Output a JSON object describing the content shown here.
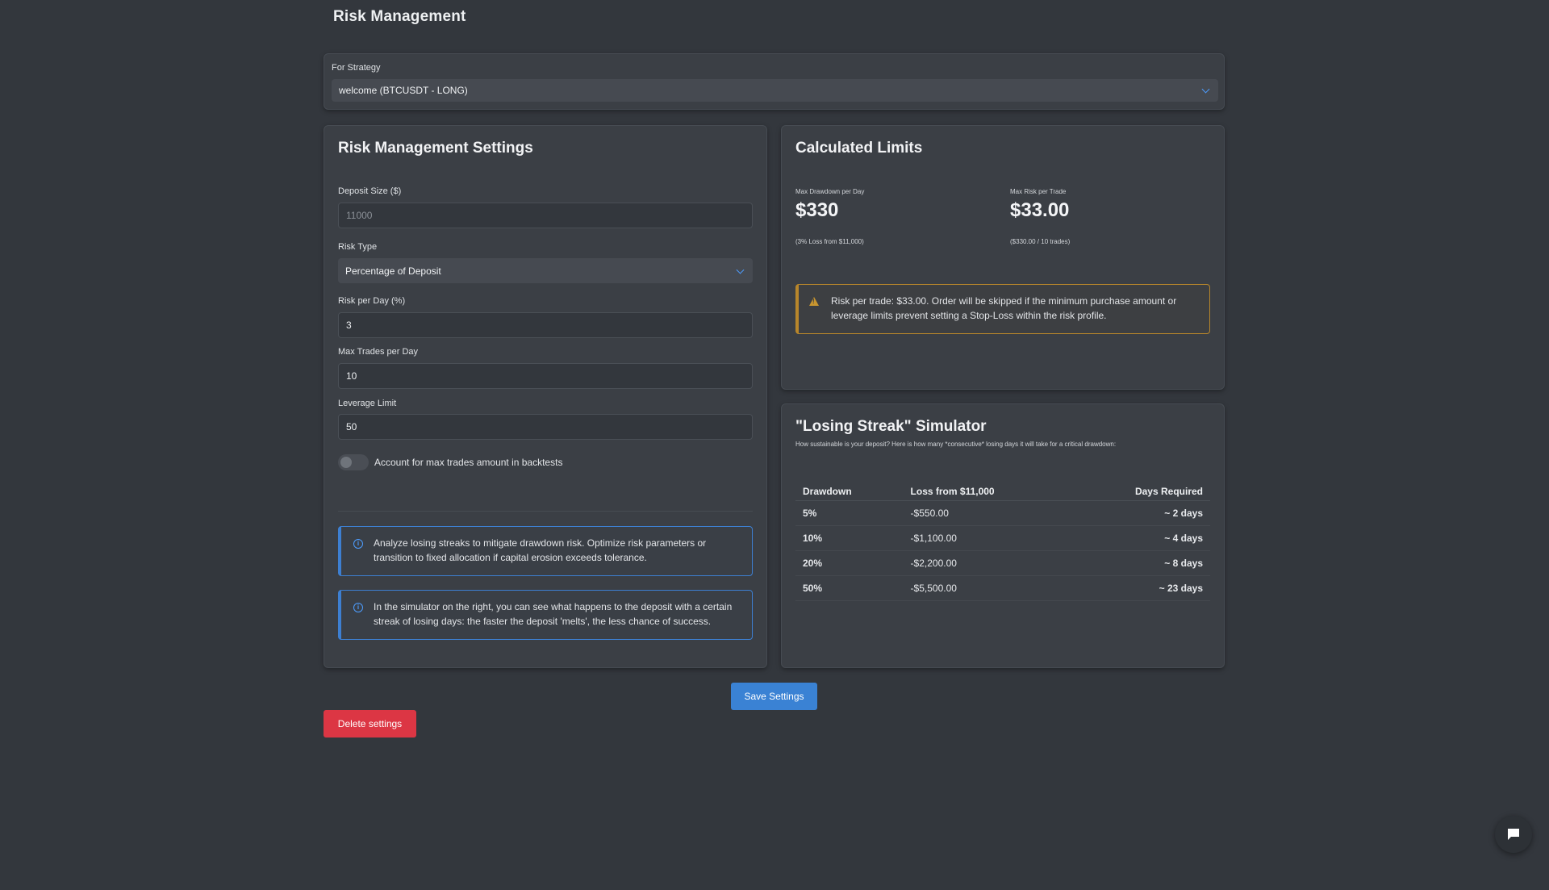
{
  "page": {
    "title": "Risk Management"
  },
  "strategy": {
    "label": "For Strategy",
    "selected": "welcome (BTCUSDT - LONG)"
  },
  "settings": {
    "title": "Risk Management Settings",
    "deposit": {
      "label": "Deposit Size ($)",
      "placeholder": "11000"
    },
    "risk_type": {
      "label": "Risk Type",
      "selected": "Percentage of Deposit"
    },
    "risk_per_day": {
      "label": "Risk per Day (%)",
      "value": "3"
    },
    "max_trades": {
      "label": "Max Trades per Day",
      "value": "10"
    },
    "leverage": {
      "label": "Leverage Limit",
      "value": "50"
    },
    "toggle": {
      "label": "Account for max trades amount in backtests",
      "checked": false
    },
    "info1": "Analyze losing streaks to mitigate drawdown risk. Optimize risk parameters or transition to fixed allocation if capital erosion exceeds tolerance.",
    "info2": "In the simulator on the right, you can see what happens to the deposit with a certain streak of losing days: the faster the deposit 'melts', the less chance of success."
  },
  "limits": {
    "title": "Calculated Limits",
    "drawdown": {
      "label": "Max Drawdown per Day",
      "value": "$330",
      "note": "(3% Loss from $11,000)"
    },
    "risk_trade": {
      "label": "Max Risk per Trade",
      "value": "$33.00",
      "note": "($330.00 / 10 trades)"
    },
    "warning": "Risk per trade: $33.00. Order will be skipped if the minimum purchase amount or leverage limits prevent setting a Stop-Loss within the risk profile."
  },
  "simulator": {
    "title": "\"Losing Streak\" Simulator",
    "subtitle": "How sustainable is your deposit? Here is how many *consecutive* losing days it will take for a critical drawdown:",
    "headers": [
      "Drawdown",
      "Loss from $11,000",
      "Days Required"
    ],
    "rows": [
      [
        "5%",
        "-$550.00",
        "~ 2 days"
      ],
      [
        "10%",
        "-$1,100.00",
        "~ 4 days"
      ],
      [
        "20%",
        "-$2,200.00",
        "~ 8 days"
      ],
      [
        "50%",
        "-$5,500.00",
        "~ 23 days"
      ]
    ]
  },
  "actions": {
    "save": "Save Settings",
    "delete": "Delete settings"
  },
  "icons": {
    "select": "chevron-down-icon",
    "info": "info-icon",
    "warning": "warning-icon",
    "chat": "chat-icon"
  },
  "colors": {
    "accent": "#3a82d4",
    "danger": "#dc3644",
    "warning": "#b8862b",
    "background": "#33373d"
  }
}
